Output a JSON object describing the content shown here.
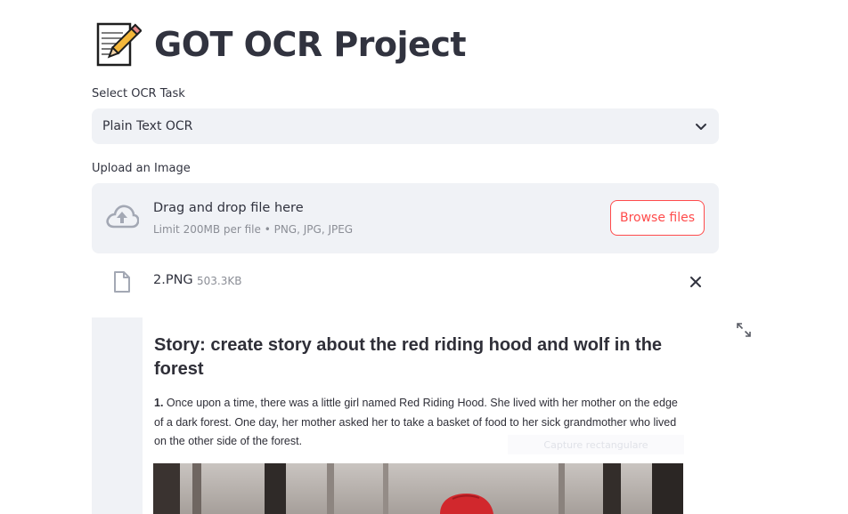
{
  "header": {
    "title": "GOT OCR Project",
    "emoji_icon": "memo-pencil-icon"
  },
  "task_select": {
    "label": "Select OCR Task",
    "value": "Plain Text OCR"
  },
  "uploader": {
    "label": "Upload an Image",
    "drop_text": "Drag and drop file here",
    "limit_text": "Limit 200MB per file • PNG, JPG, JPEG",
    "browse_label": "Browse files",
    "accent_color": "#ff4b4b"
  },
  "uploaded_file": {
    "name": "2.PNG",
    "size": "503.3KB"
  },
  "preview": {
    "doc_title": "Story: create story about the red riding hood and wolf in the forest",
    "paragraph_number": "1.",
    "paragraph_text": "Once upon a time, there was a little girl named Red Riding Hood. She lived with her mother on the edge of a dark forest. One day, her mother asked her to take a basket of food to her sick grandmother who lived on the other side of the forest.",
    "overlay_text": "Capture rectangulare"
  }
}
